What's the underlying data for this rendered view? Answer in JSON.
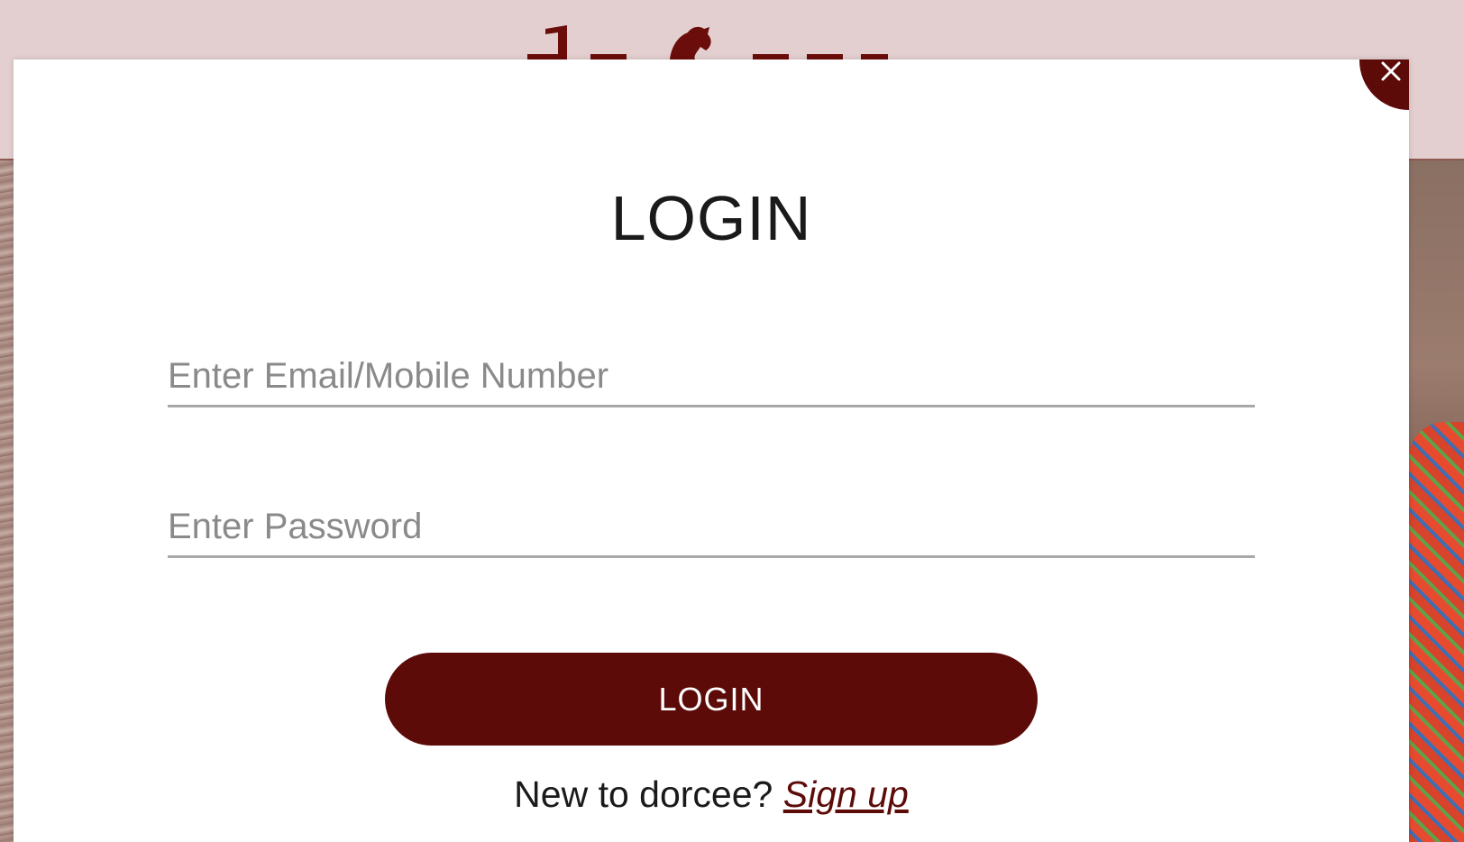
{
  "brand": {
    "name": "dorcee",
    "primary_color": "#5c0b08",
    "logo_icon": "horse-logo-icon"
  },
  "modal": {
    "title": "LOGIN",
    "close_icon": "close-icon",
    "email_placeholder": "Enter Email/Mobile Number",
    "password_placeholder": "Enter Password",
    "login_button": "LOGIN",
    "signup_prompt": "New to dorcee?",
    "signup_link": "Sign up"
  }
}
